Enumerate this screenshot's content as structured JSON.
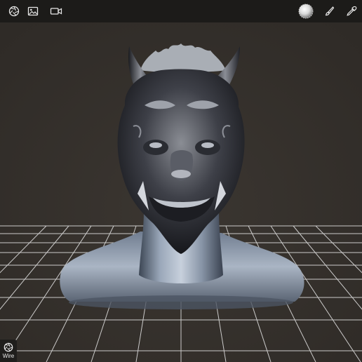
{
  "toolbar": {
    "left_icons": [
      "aperture-icon",
      "image-icon",
      "video-camera-icon"
    ],
    "right_icons": [
      "material-sphere-icon",
      "brush-icon",
      "eyedropper-icon"
    ]
  },
  "viewport": {
    "background_color": "#34302b",
    "grid_color": "#e6e6e6",
    "model": "oni-mask-bust"
  },
  "wire_toggle": {
    "label": "Wire",
    "icon": "aperture-icon"
  }
}
